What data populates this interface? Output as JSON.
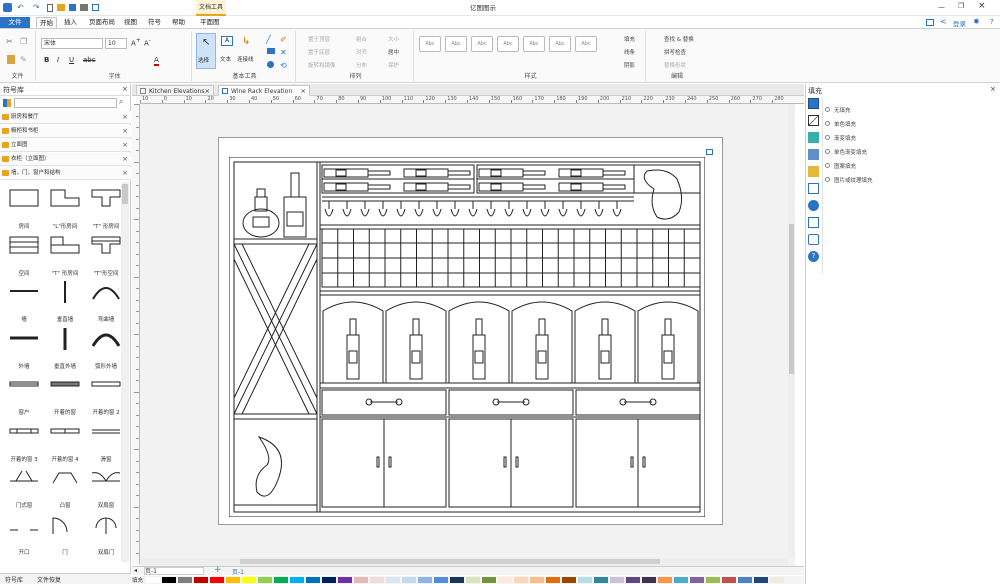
{
  "window": {
    "title": "亿图图示",
    "context_tab": "文档工具"
  },
  "menu": {
    "items": [
      {
        "label": "文件"
      },
      {
        "label": "开始"
      },
      {
        "label": "插入"
      },
      {
        "label": "页面布局"
      },
      {
        "label": "视图"
      },
      {
        "label": "符号"
      },
      {
        "label": "帮助"
      },
      {
        "label": "平面图"
      }
    ],
    "login": "登录"
  },
  "ribbon": {
    "groups": {
      "file": "文件",
      "font": "字体",
      "basic_tools": "基本工具",
      "arrange": "排列",
      "style": "样式",
      "edit": "编辑"
    },
    "font_name": "宋体",
    "font_size": "10",
    "tools": {
      "select": "选择",
      "text": "文本",
      "connector": "连接线"
    },
    "arrange": {
      "bring_front": "置于顶层",
      "send_back": "置于底层",
      "rotate": "旋转和镜像",
      "group": "组合",
      "align": "对齐",
      "distribute": "分布",
      "size": "大小",
      "center": "居中",
      "protect": "保护"
    },
    "style_swatches": [
      "Abc",
      "Abc",
      "Abc",
      "Abc",
      "Abc",
      "Abc",
      "Abc"
    ],
    "style_opts": {
      "fill": "填充",
      "line": "线条",
      "shadow": "阴影"
    },
    "edit": {
      "find": "查找 & 替换",
      "spell": "拼写检查",
      "replace_shape": "替换形状"
    }
  },
  "library": {
    "title": "符号库",
    "categories": [
      {
        "label": "厨房和餐厅"
      },
      {
        "label": "橱柜和书柜"
      },
      {
        "label": "立面图"
      },
      {
        "label": "衣柜（立面图）"
      },
      {
        "label": "墙，门，窗户和结构"
      }
    ],
    "shapes": [
      {
        "label": "房间"
      },
      {
        "label": "\"L\"形房间"
      },
      {
        "label": "\"T\" 形房间"
      },
      {
        "label": "空间"
      },
      {
        "label": "\"T\" 形房间"
      },
      {
        "label": "\"T\"形空间"
      },
      {
        "label": "墙"
      },
      {
        "label": "垂直墙"
      },
      {
        "label": "弯曲墙"
      },
      {
        "label": "外墙"
      },
      {
        "label": "垂直外墙"
      },
      {
        "label": "弧形外墙"
      },
      {
        "label": "窗户"
      },
      {
        "label": "开着的窗"
      },
      {
        "label": "开着的窗 2"
      },
      {
        "label": "开着的窗 3"
      },
      {
        "label": "开着的窗 4"
      },
      {
        "label": "滑窗"
      },
      {
        "label": "门式窗"
      },
      {
        "label": "凸窗"
      },
      {
        "label": "双扇窗"
      },
      {
        "label": "开口"
      },
      {
        "label": "门"
      },
      {
        "label": "双扇门"
      }
    ],
    "bottom_tabs": {
      "lib": "符号库",
      "recover": "文件恢复"
    }
  },
  "tabs": [
    {
      "label": "Kitchen Elevations"
    },
    {
      "label": "Wine Rack Elevation"
    }
  ],
  "ruler_ticks": [
    "10",
    "0",
    "10",
    "20",
    "30",
    "40",
    "50",
    "60",
    "70",
    "80",
    "90",
    "100",
    "110",
    "120",
    "130",
    "140",
    "150",
    "160",
    "170",
    "180",
    "190",
    "200",
    "210",
    "220",
    "230",
    "240",
    "250",
    "260",
    "270",
    "280"
  ],
  "status": {
    "page": "页-1",
    "page_tab": "页-1",
    "fill_label": "填充"
  },
  "fill_panel": {
    "title": "填充",
    "options": [
      {
        "label": "无填充"
      },
      {
        "label": "单色填充"
      },
      {
        "label": "渐变填充"
      },
      {
        "label": "单色渐变填充"
      },
      {
        "label": "图案填充"
      },
      {
        "label": "图片或纹理填充"
      }
    ]
  },
  "colors": {
    "accent": "#2b73c4",
    "folder": "#e8a31f"
  },
  "palette": [
    "#ffffff",
    "#000000",
    "#7f7f7f",
    "#c00000",
    "#ff0000",
    "#ffc000",
    "#ffff00",
    "#92d050",
    "#00b050",
    "#00b0f0",
    "#0070c0",
    "#002060",
    "#7030a0",
    "#e6b8b7",
    "#f2dcdb",
    "#dce6f1",
    "#c5d9f1",
    "#8db4e2",
    "#538dd5",
    "#16365c",
    "#d8e4bc",
    "#76933c",
    "#fde9d9",
    "#fcd5b4",
    "#fabf8f",
    "#e26b0a",
    "#974706",
    "#b7dee8",
    "#31869b",
    "#ccc0da",
    "#60497a",
    "#403151",
    "#f79646",
    "#4bacc6",
    "#8064a2",
    "#9bbb59",
    "#c0504d",
    "#4f81bd",
    "#1f497d",
    "#eeece1"
  ]
}
